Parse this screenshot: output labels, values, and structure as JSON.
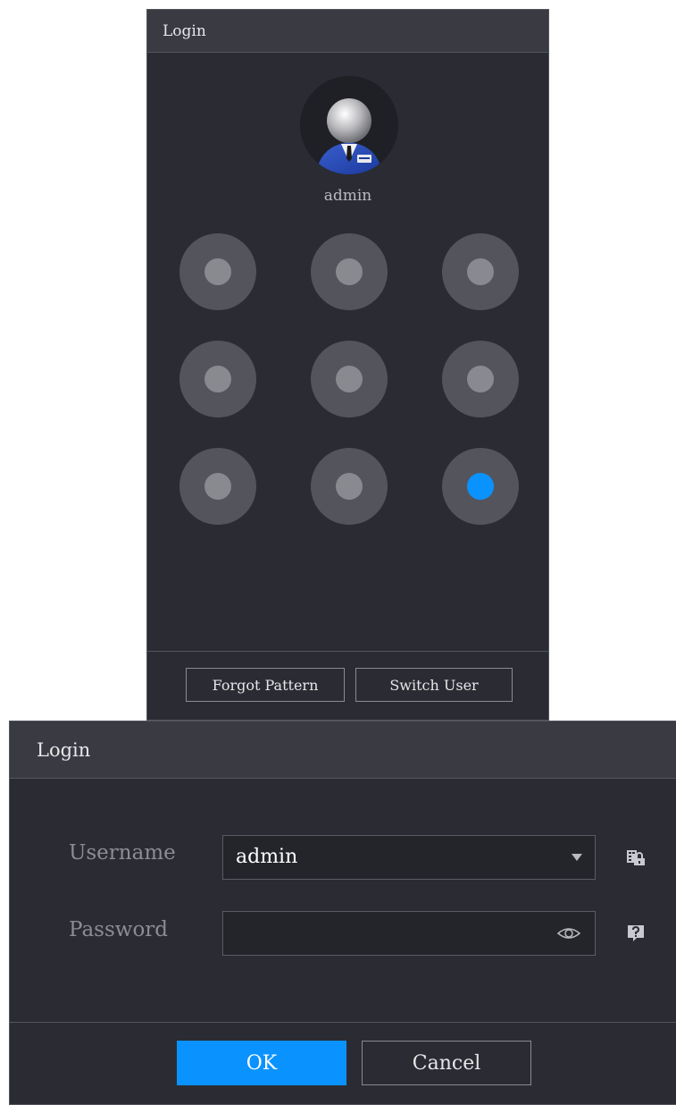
{
  "pattern_dialog": {
    "title": "Login",
    "user_name": "admin",
    "grid": {
      "rows": 3,
      "cols": 3,
      "active_node": 9
    },
    "buttons": {
      "forgot_pattern": "Forgot Pattern",
      "switch_user": "Switch User"
    },
    "icons": {
      "avatar": "user-avatar-icon"
    }
  },
  "password_dialog": {
    "title": "Login",
    "username": {
      "label": "Username",
      "value": "admin"
    },
    "password": {
      "label": "Password",
      "value": ""
    },
    "icons": {
      "dropdown": "chevron-down-icon",
      "show_password": "eye-icon",
      "lock_keyboard": "keyboard-lock-icon",
      "help": "help-icon"
    },
    "buttons": {
      "ok": "OK",
      "cancel": "Cancel"
    }
  },
  "colors": {
    "accent": "#0a93ff",
    "dialog_bg": "#2b2c33",
    "titlebar_bg": "#393a42"
  }
}
